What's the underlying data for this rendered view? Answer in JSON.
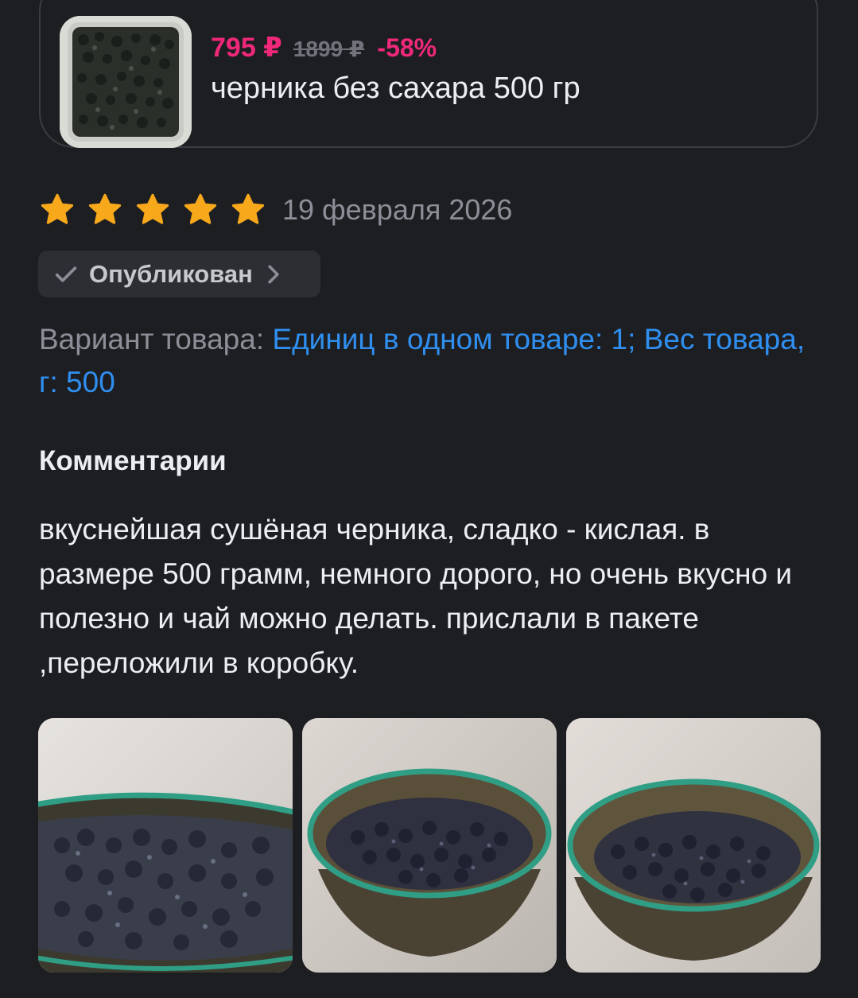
{
  "product": {
    "price_current": "795 ₽",
    "price_old": "1899 ₽",
    "discount": "-58%",
    "name": "черника без сахара 500 гр",
    "thumbnail_icon": "product-photo"
  },
  "review": {
    "rating": 5,
    "rating_max": 5,
    "star_color": "#f7a81b",
    "date": "19 февраля 2026",
    "status": {
      "label": "Опубликован",
      "icon": "check-icon",
      "chevron": "chevron-right-icon"
    },
    "variant": {
      "label": "Вариант товара: ",
      "value": "Единиц в одном товаре: 1; Вес товара, г: 500"
    },
    "comments_title": "Комментарии",
    "comment": "вкуснейшая сушёная черника, сладко - кислая. в размере 500 грамм, немного дорого, но очень вкусно и полезно и чай можно делать. прислали в пакете ,переложили в коробку.",
    "photos": [
      "photo-1",
      "photo-2",
      "photo-3"
    ]
  },
  "colors": {
    "background": "#1d1e22",
    "accent_price": "#f0287a",
    "link_blue": "#2f8ff0",
    "muted_text": "#8c8f97"
  }
}
